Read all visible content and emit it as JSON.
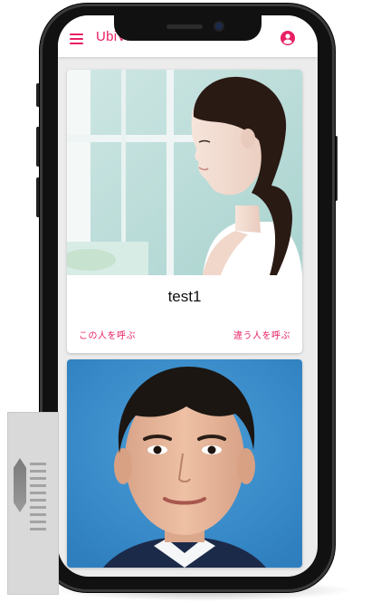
{
  "appbar": {
    "title": "UbiVis",
    "menu_icon": "menu-icon",
    "account_icon": "account-circle-icon",
    "accent_color": "#e91e63"
  },
  "cards": [
    {
      "name": "test1",
      "actions": {
        "call": "この人を呼ぶ",
        "other": "違う人を呼ぶ"
      }
    },
    {
      "name": ""
    }
  ]
}
